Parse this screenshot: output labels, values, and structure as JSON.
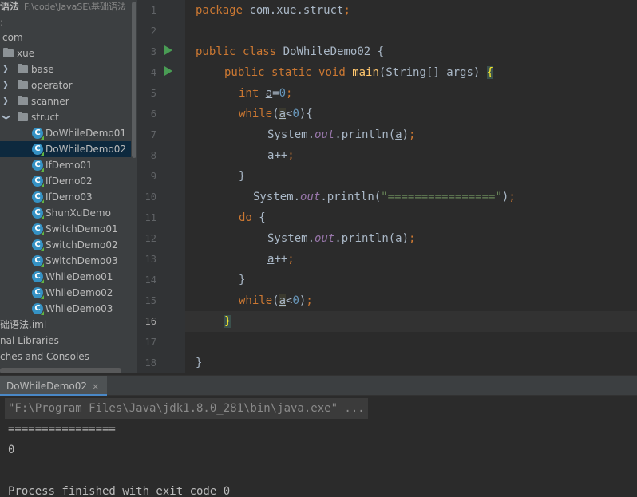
{
  "project_tree": {
    "root_name": "语法",
    "root_path": "F:\\code\\JavaSE\\基础语法",
    "items": [
      {
        "label": "com"
      },
      {
        "label": "xue"
      },
      {
        "label": "base"
      },
      {
        "label": "operator"
      },
      {
        "label": "scanner"
      },
      {
        "label": "struct"
      },
      {
        "label": "DoWhileDemo01"
      },
      {
        "label": "DoWhileDemo02"
      },
      {
        "label": "IfDemo01"
      },
      {
        "label": "IfDemo02"
      },
      {
        "label": "IfDemo03"
      },
      {
        "label": "ShunXuDemo"
      },
      {
        "label": "SwitchDemo01"
      },
      {
        "label": "SwitchDemo02"
      },
      {
        "label": "SwitchDemo03"
      },
      {
        "label": "WhileDemo01"
      },
      {
        "label": "WhileDemo02"
      },
      {
        "label": "WhileDemo03"
      },
      {
        "label": "础语法.iml"
      },
      {
        "label": "nal Libraries"
      },
      {
        "label": "ches and Consoles"
      }
    ],
    "class_icon_letter": "C",
    "selected": "DoWhileDemo02"
  },
  "editor": {
    "current_line": 16,
    "line_numbers": [
      "1",
      "2",
      "3",
      "4",
      "5",
      "6",
      "7",
      "8",
      "9",
      "10",
      "11",
      "12",
      "13",
      "14",
      "15",
      "16",
      "17",
      "18"
    ],
    "tokens": {
      "package_kw": "package",
      "package_name": " com.xue.struct",
      "semicolon": ";",
      "public_kw": "public",
      "class_kw": "class",
      "class_name": "DoWhileDemo02",
      "open_brace": "{",
      "close_brace": "}",
      "static_kw": "static",
      "void_kw": "void",
      "main_fn": "main",
      "main_params": "(String[] args) ",
      "int_kw": "int",
      "var_a": "a",
      "equals": "=",
      "zero": "0",
      "while_kw": "while",
      "open_paren": "(",
      "close_paren": ")",
      "less_than": "<",
      "system": "System.",
      "out_field": "out",
      "println": ".println(",
      "incr": "++",
      "do_kw": "do",
      "separator_string": "\"================\""
    }
  },
  "run_panel": {
    "tab_label": "DoWhileDemo02",
    "tab_close": "×",
    "output": [
      "\"F:\\Program Files\\Java\\jdk1.8.0_281\\bin\\java.exe\" ...",
      "================",
      "0",
      "",
      "Process finished with exit code 0"
    ]
  }
}
